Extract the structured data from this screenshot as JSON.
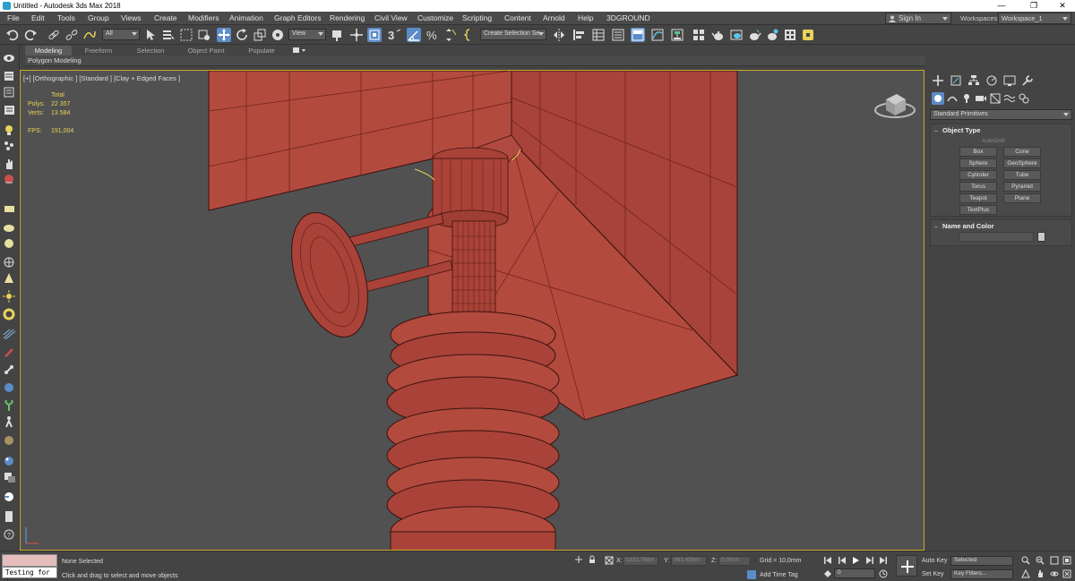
{
  "window": {
    "title": "Untitled - Autodesk 3ds Max 2018",
    "minimize": "—",
    "maximize": "❐",
    "close": "✕"
  },
  "menu": {
    "items": [
      "File",
      "Edit",
      "Tools",
      "Group",
      "Views",
      "Create",
      "Modifiers",
      "Animation",
      "Graph Editors",
      "Rendering",
      "Civil View",
      "Customize",
      "Scripting",
      "Content",
      "Arnold",
      "Help",
      "3DGROUND"
    ],
    "sign_in": "Sign In",
    "workspaces_label": "Workspaces:",
    "workspace_value": "Workspace_1"
  },
  "toolbar": {
    "selection_filter": "All",
    "reference_coord": "View",
    "snap_label": "3",
    "named_selection": "Create Selection Se"
  },
  "ribbon": {
    "tabs": [
      "Modeling",
      "Freeform",
      "Selection",
      "Object Paint",
      "Populate"
    ],
    "active_tab": "Modeling",
    "sub_label": "Polygon Modeling"
  },
  "viewport": {
    "label": "[+] [Orthographic ] [Standard ] [Clay + Edged Faces ]",
    "stats": {
      "total_label": "Total",
      "polys_label": "Polys:",
      "polys_value": "22 357",
      "verts_label": "Verts:",
      "verts_value": "13 584",
      "fps_label": "FPS:",
      "fps_value": "191,004"
    }
  },
  "command_panel": {
    "category": "Standard Primitives",
    "object_type_title": "Object Type",
    "autogrid": "AutoGrid",
    "primitives": [
      "Box",
      "Cone",
      "Sphere",
      "GeoSphere",
      "Cylinder",
      "Tube",
      "Torus",
      "Pyramid",
      "Teapot",
      "Plane",
      "TextPlus"
    ],
    "name_color_title": "Name and Color",
    "rollout_minus": "–"
  },
  "status": {
    "maxscript_text": "Testing for :",
    "selection_status": "None Selected",
    "prompt": "Click and drag to select and move objects",
    "x_label": "X:",
    "x_value": "1332,768m",
    "y_label": "Y:",
    "y_value": "961,458m",
    "z_label": "Z:",
    "z_value": "0,0mm",
    "grid": "Grid = 10,0mm",
    "add_time_tag": "Add Time Tag",
    "frame": "0",
    "auto_key": "Auto Key",
    "set_key": "Set Key",
    "key_mode": "Selected",
    "key_filters": "Key Filters..."
  },
  "colors": {
    "accent": "#5b8cc7",
    "viewport_border": "#c8a82a",
    "model_fill": "#b24a3e",
    "stats": "#e8d25a"
  }
}
